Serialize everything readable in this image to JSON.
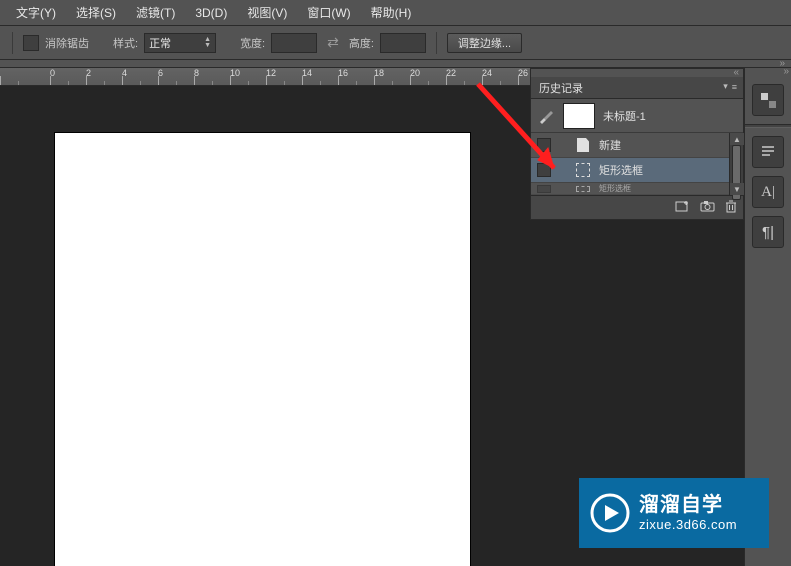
{
  "menu": {
    "text": {
      "label": "文字(Y)"
    },
    "select": {
      "label": "选择(S)"
    },
    "filter": {
      "label": "滤镜(T)"
    },
    "threeD": {
      "label": "3D(D)"
    },
    "view": {
      "label": "视图(V)"
    },
    "window": {
      "label": "窗口(W)"
    },
    "help": {
      "label": "帮助(H)"
    }
  },
  "options": {
    "antialias_label": "消除锯齿",
    "style_label": "样式:",
    "style_value": "正常",
    "width_label": "宽度:",
    "height_label": "高度:",
    "refine_label": "调整边缘..."
  },
  "ruler_labels": [
    "0",
    "2",
    "4",
    "6",
    "8",
    "10",
    "12",
    "14",
    "16",
    "18",
    "20",
    "22",
    "24",
    "26"
  ],
  "history": {
    "title": "历史记录",
    "snapshot_name": "未标题-1",
    "items": [
      {
        "icon": "file",
        "label": "新建"
      },
      {
        "icon": "marquee",
        "label": "矩形选框"
      },
      {
        "icon": "marquee",
        "label": "矩形选框"
      }
    ]
  },
  "watermark": {
    "main": "溜溜自学",
    "sub": "zixue.3d66.com"
  }
}
